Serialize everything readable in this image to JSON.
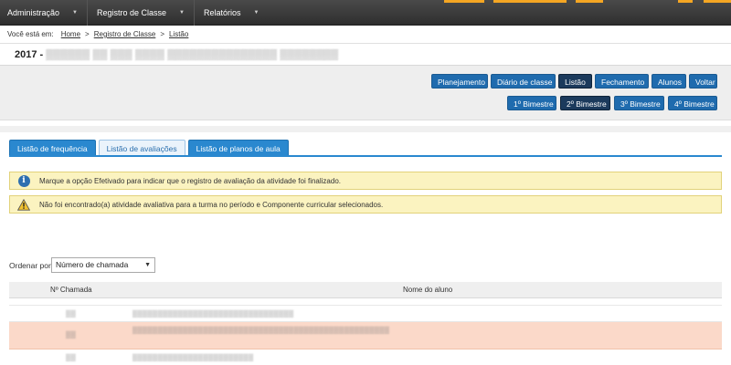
{
  "menu": {
    "items": [
      {
        "label": "Administração"
      },
      {
        "label": "Registro de Classe"
      },
      {
        "label": "Relatórios"
      }
    ],
    "caret": "▼"
  },
  "breadcrumb": {
    "prefix": "Você está em:",
    "items": [
      "Home",
      "Registro de Classe",
      "Listão"
    ],
    "separator": ">"
  },
  "header": {
    "year": "2017 -",
    "obscured_title": "▒▒▒▒▒▒ ▒▒ ▒▒▒ ▒▒▒▒ ▒▒▒▒▒▒▒▒▒▒▒▒▒▒▒ ▒▒▒▒▒▒▒▒"
  },
  "actions": {
    "row1": [
      "Planejamento",
      "Diário de classe",
      "Listão",
      "Fechamento",
      "Alunos",
      "Voltar"
    ],
    "row2": [
      "1º Bimestre",
      "2º Bimestre",
      "3º Bimestre",
      "4º Bimestre"
    ],
    "active_row1": "Listão",
    "active_row2": "2º Bimestre"
  },
  "tabs": [
    "Listão de frequência",
    "Listão de avaliações",
    "Listão de planos de aula"
  ],
  "alerts": {
    "info": "Marque a opção Efetivado para indicar que o registro de avaliação da atividade foi finalizado.",
    "warning": "Não foi encontrado(a) atividade avaliativa para a turma no período e Componente curricular selecionados."
  },
  "sort": {
    "label": "Ordenar por:",
    "selected": "Número de chamada",
    "arrow": "▼"
  },
  "table": {
    "headers": [
      "Nº Chamada",
      "Nome do aluno"
    ],
    "rows": [
      {
        "num": "▒▒",
        "name": "▒▒▒▒▒▒▒▒▒▒▒▒▒▒▒▒▒▒▒▒▒▒▒▒▒▒▒▒▒▒▒▒"
      },
      {
        "num": "▒▒",
        "name": "▒▒▒▒▒▒▒▒▒▒▒▒▒▒▒▒▒▒▒▒▒▒▒▒▒▒▒▒▒▒▒▒▒▒▒▒▒▒▒▒▒▒▒▒▒▒▒▒▒▒▒"
      },
      {
        "num": "▒▒",
        "name": "▒▒▒▒▒▒▒▒▒▒▒▒▒▒▒▒▒▒▒▒▒▒▒▒"
      }
    ]
  },
  "colors": {
    "primary_button": "#1f6bae",
    "active_button": "#1b3a5c",
    "tab_blue": "#2a88cf",
    "alert_bg": "#fbf3c0",
    "highlight_row": "#fbd9c9"
  }
}
